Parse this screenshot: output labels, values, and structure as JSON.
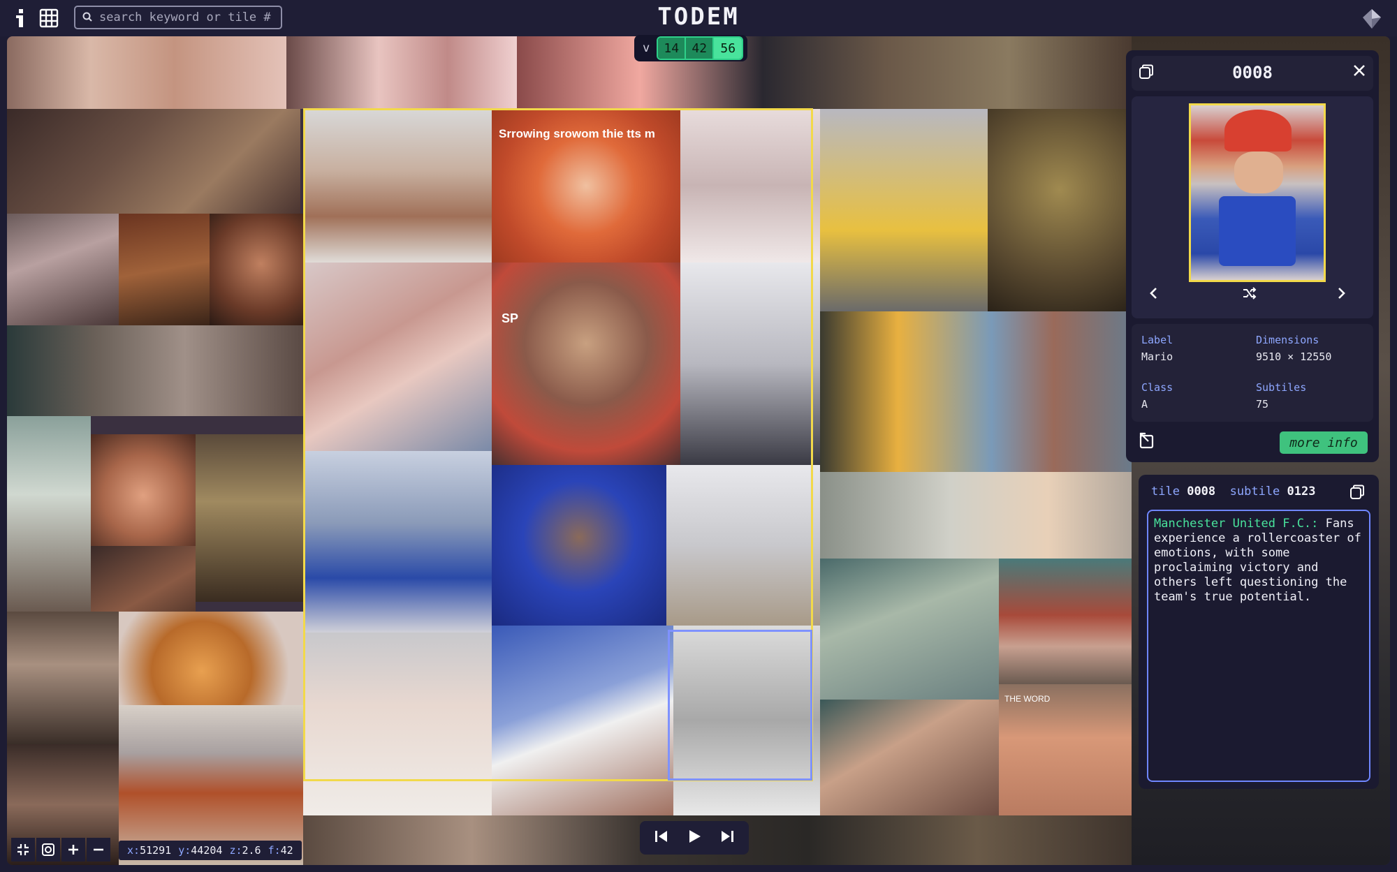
{
  "header": {
    "app_title": "TODEM",
    "search_placeholder": "search keyword or tile #",
    "info_icon": "info-icon",
    "grid_icon": "grid-icon",
    "search_icon": "search-icon",
    "logo_icon": "gem-logo-icon"
  },
  "versions": {
    "label": "v",
    "options": [
      "14",
      "42",
      "56"
    ],
    "selected": "56"
  },
  "tile_panel": {
    "tile_id": "0008",
    "label_key": "Label",
    "label_value": "Mario",
    "dimensions_key": "Dimensions",
    "dimensions_value": "9510 × 12550",
    "class_key": "Class",
    "class_value": "A",
    "subtiles_key": "Subtiles",
    "subtiles_value": "75",
    "more_info_label": "more info"
  },
  "description_panel": {
    "tile_key": "tile",
    "tile_value": "0008",
    "subtile_key": "subtile",
    "subtile_value": "0123",
    "subject": "Manchester United F.C.:",
    "text": "Fans experience a rollercoaster of emotions, with some proclaiming victory and others left questioning the team's true potential."
  },
  "coordinates": {
    "x_key": "x:",
    "x_value": "51291",
    "y_key": "y:",
    "y_value": "44204",
    "z_key": "z:",
    "z_value": "2.6",
    "f_key": "f:",
    "f_value": "42"
  },
  "mosaic_captions": {
    "sorrow_text": "Srrowing srowom thie tts m",
    "sp_text": "SP",
    "word_text": "THE WORD"
  },
  "colors": {
    "accent_green": "#49e39c",
    "accent_yellow": "#f2d94a",
    "accent_blue": "#7f92ff",
    "panel_bg": "#1b1a30"
  }
}
